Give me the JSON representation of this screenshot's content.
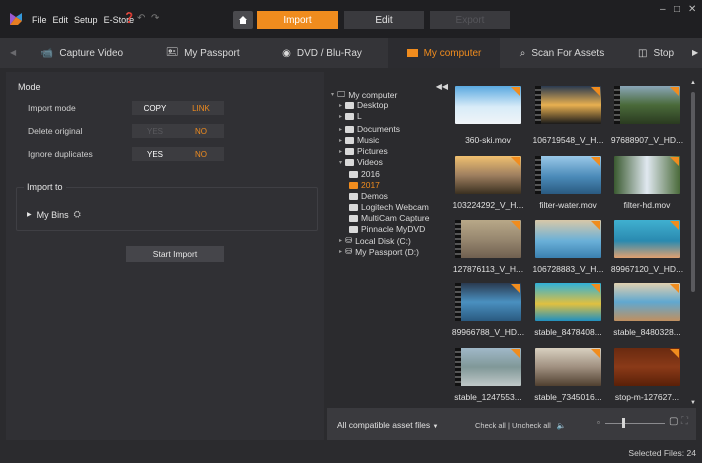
{
  "menu": [
    "File",
    "Edit",
    "Setup",
    "E-Store"
  ],
  "modes": {
    "import": "Import",
    "edit": "Edit",
    "export": "Export"
  },
  "tabs": [
    {
      "label": "Capture Video",
      "icon": "camera-icon"
    },
    {
      "label": "My Passport",
      "icon": "drive-icon"
    },
    {
      "label": "DVD / Blu-Ray",
      "icon": "disc-icon"
    },
    {
      "label": "My computer",
      "icon": "folder-icon"
    },
    {
      "label": "Scan For Assets",
      "icon": "search-icon"
    },
    {
      "label": "Stop",
      "icon": "stop-motion-icon"
    }
  ],
  "left": {
    "mode_title": "Mode",
    "rows": [
      {
        "label": "Import mode",
        "a": "COPY",
        "b": "LINK"
      },
      {
        "label": "Delete original",
        "a": "YES",
        "b": "NO"
      },
      {
        "label": "Ignore duplicates",
        "a": "YES",
        "b": "NO"
      }
    ],
    "import_to": "Import to",
    "my_bins": "My Bins",
    "start_import": "Start Import"
  },
  "tree": {
    "root": "My computer",
    "desktop": "Desktop",
    "l": "L",
    "documents": "Documents",
    "music": "Music",
    "pictures": "Pictures",
    "videos": "Videos",
    "y2016": "2016",
    "y2017": "2017",
    "demos": "Demos",
    "logitech": "Logitech Webcam",
    "multicam": "MultiCam Capture",
    "pinnacle": "Pinnacle MyDVD",
    "localdisk": "Local Disk (C:)",
    "passport": "My Passport (D:)"
  },
  "thumbs": [
    "360-ski.mov",
    "106719548_V_H...",
    "97688907_V_HD...",
    "103224292_V_H...",
    "filter-water.mov",
    "filter-hd.mov",
    "127876113_V_H...",
    "106728883_V_H...",
    "89967120_V_HD...",
    "89966788_V_HD...",
    "stable_8478408...",
    "stable_8480328...",
    "stable_1247553...",
    "stable_7345016...",
    "stop-m-127627..."
  ],
  "bottom": {
    "filter": "All compatible asset files",
    "check_all": "Check all",
    "uncheck_all": "Uncheck all"
  },
  "status": {
    "selected_files": "Selected Files: 24"
  },
  "colors": {
    "accent": "#f08c1e",
    "panel": "#303034",
    "bg": "#2b2b2e"
  }
}
